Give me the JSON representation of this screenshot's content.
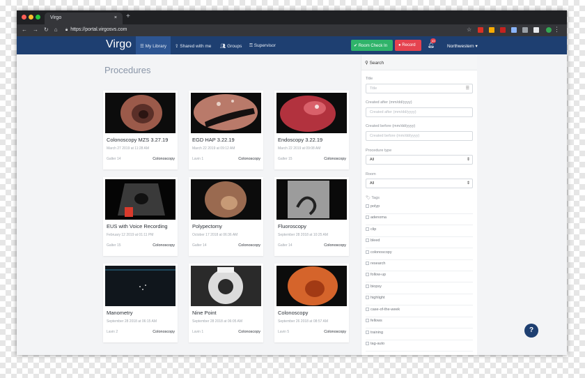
{
  "browser": {
    "tab_title": "Virgo",
    "tab_close": "×",
    "new_tab": "+",
    "url": "https://portal.virgosvs.com"
  },
  "navbar": {
    "logo": "Virgo",
    "items": [
      {
        "label": "My Library",
        "icon": "list-icon"
      },
      {
        "label": "Shared with me",
        "icon": "share-icon"
      },
      {
        "label": "Groups",
        "icon": "users-icon"
      },
      {
        "label": "Supervisor",
        "icon": "key-icon"
      }
    ],
    "room_check_in": "Room Check In",
    "record": "Record",
    "notification_count": "43",
    "org": "Northwestern"
  },
  "page_title": "Procedures",
  "procedures": [
    {
      "name": "Colonoscopy MZS 3.27.19",
      "date": "March 27 2019 at 11:28 AM",
      "room": "Galter 14",
      "type": "Colonoscopy"
    },
    {
      "name": "EGD HAP 3.22.19",
      "date": "March 22 2019 at 09:12 AM",
      "room": "Lavin 1",
      "type": "Colonoscopy"
    },
    {
      "name": "Endoscopy 3.22.19",
      "date": "March 22 2019 at 09:08 AM",
      "room": "Galter 15",
      "type": "Colonoscopy"
    },
    {
      "name": "EUS with Voice Recording",
      "date": "February 12 2019 at 01:11 PM",
      "room": "Galter 15",
      "type": "Colonoscopy"
    },
    {
      "name": "Polypectomy",
      "date": "October 17 2018 at 06:36 AM",
      "room": "Galter 14",
      "type": "Colonoscopy"
    },
    {
      "name": "Fluoroscopy",
      "date": "September 28 2018 at 10:25 AM",
      "room": "Galter 14",
      "type": "Colonoscopy"
    },
    {
      "name": "Manometry",
      "date": "September 28 2018 at 06:15 AM",
      "room": "Lavin 2",
      "type": "Colonoscopy"
    },
    {
      "name": "Nine Point",
      "date": "September 28 2018 at 06:05 AM",
      "room": "Lavin 1",
      "type": "Colonoscopy"
    },
    {
      "name": "Colonoscopy",
      "date": "September 26 2018 at 08:57 AM",
      "room": "Lavin 5",
      "type": "Colonoscopy"
    }
  ],
  "search": {
    "heading": "Search",
    "title_label": "Title",
    "title_placeholder": "Title",
    "after_label": "Created after (mm/dd/yyyy)",
    "after_placeholder": "Created after (mm/dd/yyyy)",
    "before_label": "Created before (mm/dd/yyyy)",
    "before_placeholder": "Created before (mm/dd/yyyy)",
    "type_label": "Procedure type",
    "type_value": "All",
    "room_label": "Room",
    "room_value": "All",
    "tags_label": "Tags",
    "tags": [
      "polyp",
      "adenoma",
      "clip",
      "bleed",
      "colonoscopy",
      "research",
      "follow-up",
      "biopsy",
      "highlight",
      "case-of-the-week",
      "fellows",
      "training",
      "tag-auto"
    ]
  },
  "help": "?",
  "colors": {
    "navbar": "#1e3f71",
    "green": "#2fb36a",
    "red": "#e5434f"
  }
}
